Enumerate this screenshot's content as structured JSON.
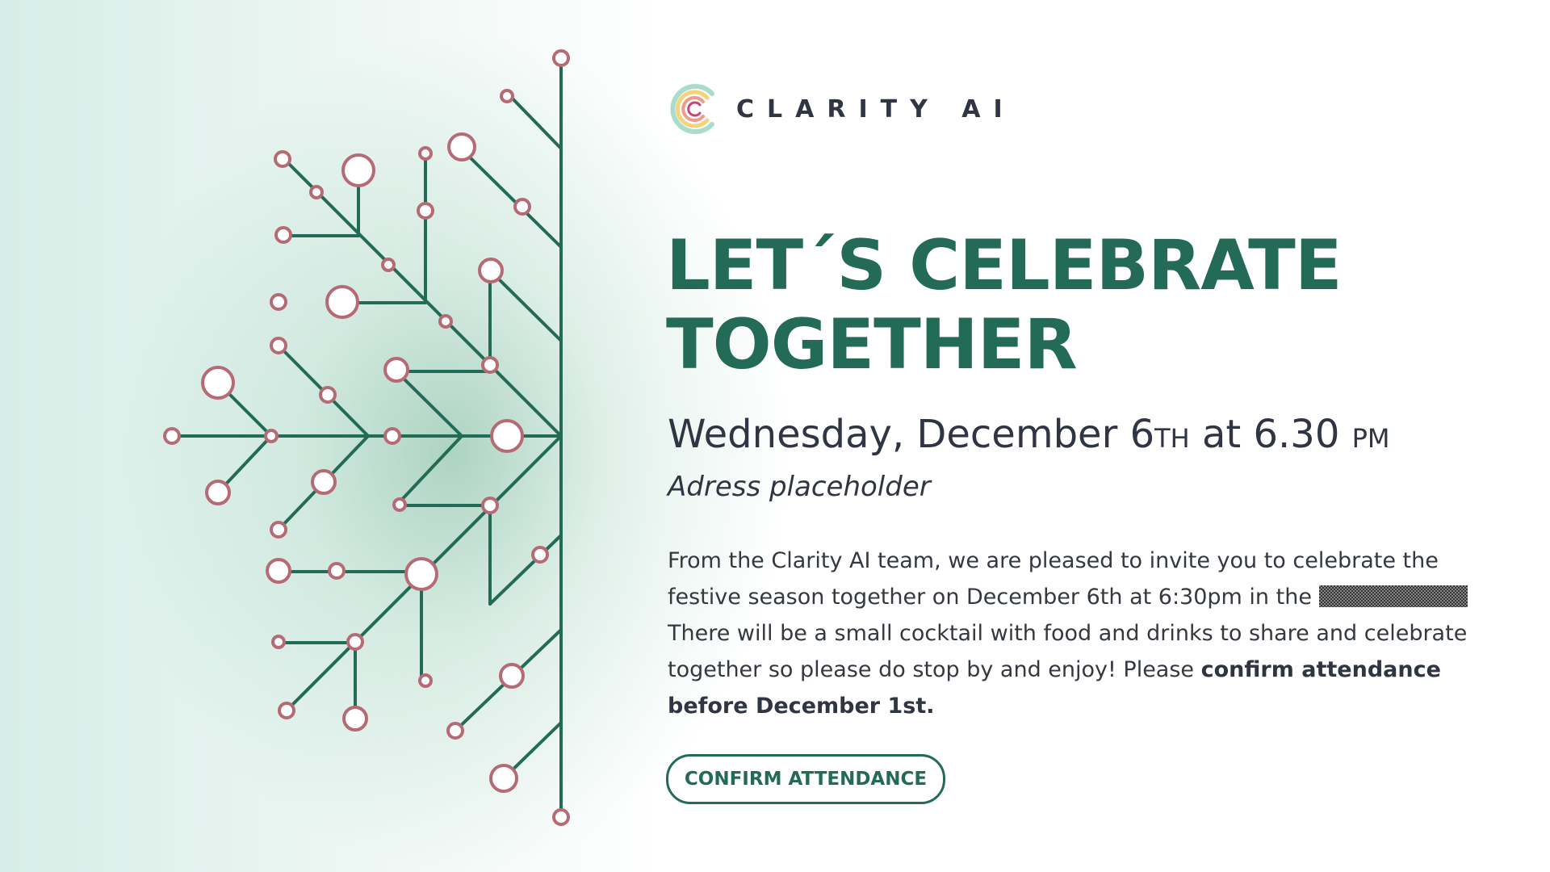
{
  "brand": {
    "name": "CLARITY AI",
    "logo_icon": "clarity-c-icon"
  },
  "hero": {
    "title_line1": "LET´S CELEBRATE",
    "title_line2": "TOGETHER"
  },
  "event": {
    "day_date": "Wednesday, December 6",
    "date_suffix": "TH",
    "at_time": " at 6.30 ",
    "time_suffix": "PM",
    "address": "Adress placeholder"
  },
  "invitation": {
    "text_part1": "From the Clarity AI team, we are pleased to invite you to celebrate the festive season together on December 6th at 6:30pm in the ",
    "text_part2": "There will be a small cocktail with food and drinks to share and celebrate together so please do stop by and enjoy! Please ",
    "text_bold": "confirm attendance before December 1st."
  },
  "cta": {
    "label": "CONFIRM ATTENDANCE"
  },
  "colors": {
    "brand_green": "#236b57",
    "node_pink": "#b56a74",
    "text_dark": "#2f3543"
  },
  "decoration": {
    "icon": "snowflake-circuit-icon"
  }
}
